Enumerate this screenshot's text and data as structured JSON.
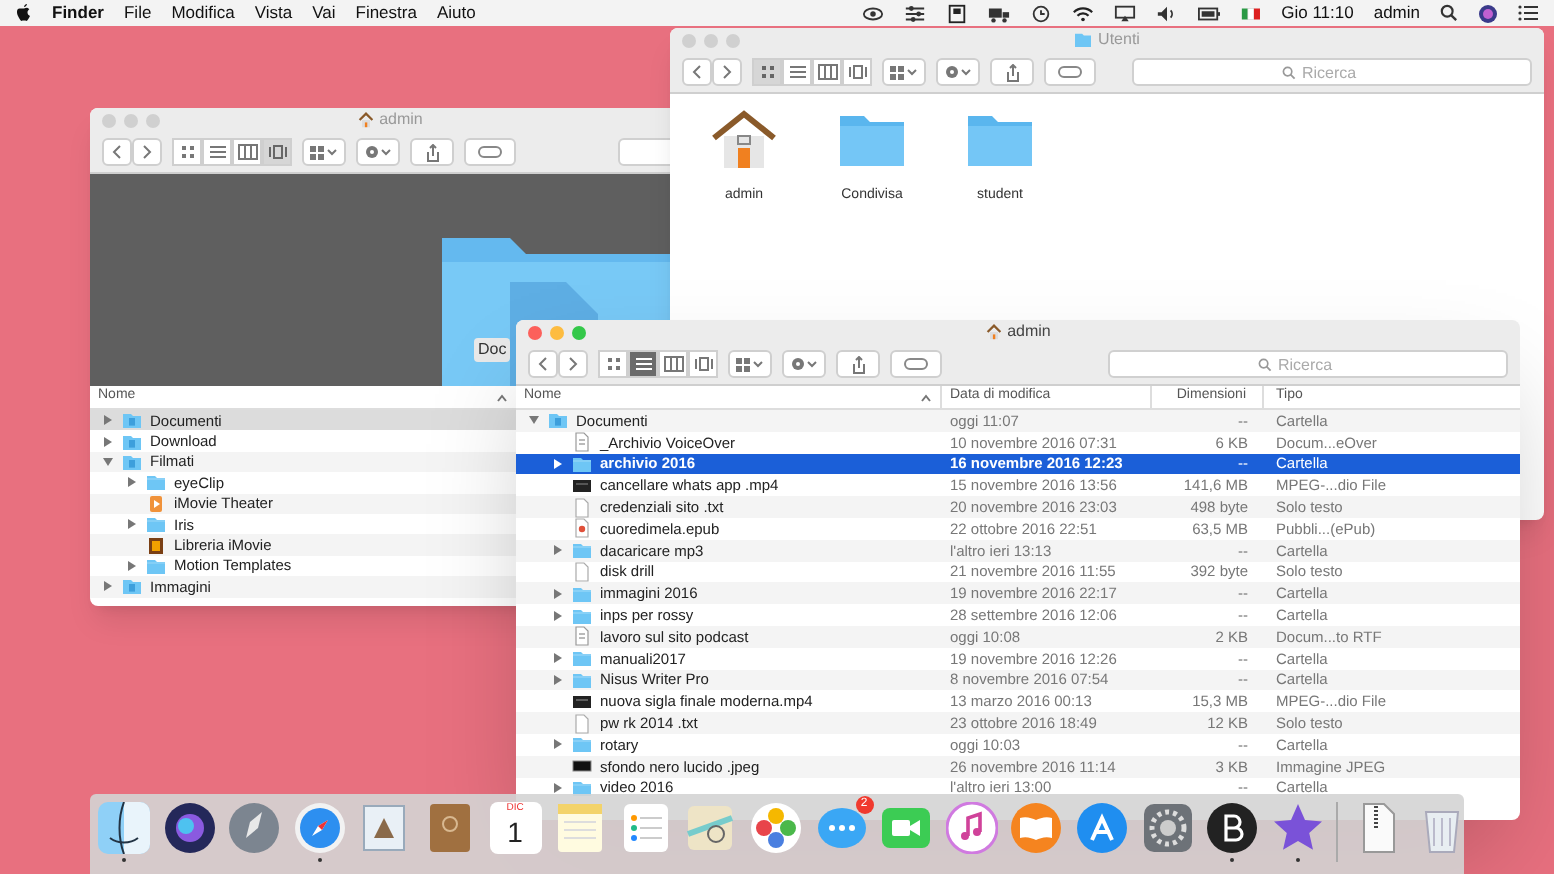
{
  "menu_bar": {
    "app": "Finder",
    "menus": [
      "File",
      "Modifica",
      "Vista",
      "Vai",
      "Finestra",
      "Aiuto"
    ],
    "clock": "Gio 11:10",
    "user": "admin"
  },
  "back_window": {
    "title": "admin",
    "active": false,
    "view_buttons": [
      {
        "kind": "icons",
        "selected": false
      },
      {
        "kind": "list",
        "selected": false
      },
      {
        "kind": "columns",
        "selected": false
      },
      {
        "kind": "cover",
        "selected": true
      }
    ],
    "preview_label": "Doc",
    "columns": [
      "Nome"
    ],
    "rows": [
      {
        "name": "Documenti",
        "kind": "docfolder",
        "selected": true,
        "expanded": false
      },
      {
        "name": "Download",
        "kind": "docfolder",
        "selected": false,
        "expanded": false
      },
      {
        "name": "Filmati",
        "kind": "docfolder",
        "selected": false,
        "expanded": true,
        "children": [
          {
            "name": "eyeClip",
            "kind": "folder",
            "selected": false,
            "expanded": false
          },
          {
            "name": "iMovie Theater",
            "kind": "app",
            "selected": false
          },
          {
            "name": "Iris",
            "kind": "folder",
            "selected": false,
            "expanded": false
          },
          {
            "name": "Libreria iMovie",
            "kind": "library",
            "selected": false
          },
          {
            "name": "Motion Templates",
            "kind": "folder",
            "selected": false,
            "expanded": false
          }
        ]
      },
      {
        "name": "Immagini",
        "kind": "docfolder",
        "selected": false,
        "expanded": false
      }
    ]
  },
  "users_window": {
    "title": "Utenti",
    "active": false,
    "view_buttons": [
      {
        "kind": "icons",
        "selected": true
      },
      {
        "kind": "list",
        "selected": false
      },
      {
        "kind": "columns",
        "selected": false
      },
      {
        "kind": "cover",
        "selected": false
      }
    ],
    "search": {
      "placeholder": "Ricerca"
    },
    "items": [
      {
        "kind": "home",
        "label": "admin"
      },
      {
        "kind": "folder",
        "label": "Condivisa"
      },
      {
        "kind": "folder",
        "label": "student"
      }
    ]
  },
  "front_window": {
    "title": "admin",
    "active": true,
    "view_buttons": [
      {
        "kind": "icons",
        "selected": false
      },
      {
        "kind": "list",
        "selected": true
      },
      {
        "kind": "columns",
        "selected": false
      },
      {
        "kind": "cover",
        "selected": false
      }
    ],
    "search": {
      "placeholder": "Ricerca"
    },
    "columns": [
      "Nome",
      "Data di modifica",
      "Dimensioni",
      "Tipo"
    ],
    "rows": [
      {
        "name": "Documenti",
        "kind": "docfolder",
        "date": "oggi 11:07",
        "size": "--",
        "type": "Cartella",
        "selected": false,
        "expanded": true,
        "children": [
          {
            "name": "_Archivio VoiceOver",
            "kind": "document",
            "date": "10 novembre 2016 07:31",
            "size": "6 KB",
            "type": "Docum...eOver",
            "selected": false
          },
          {
            "name": "archivio 2016",
            "kind": "folder",
            "date": "16 novembre 2016 12:23",
            "size": "--",
            "type": "Cartella",
            "selected": true,
            "expanded": false
          },
          {
            "name": "cancellare whats app .mp4",
            "kind": "video",
            "date": "15 novembre 2016 13:56",
            "size": "141,6 MB",
            "type": "MPEG-...dio File",
            "selected": false
          },
          {
            "name": "credenziali sito .txt",
            "kind": "text",
            "date": "20 novembre 2016 23:03",
            "size": "498 byte",
            "type": "Solo testo",
            "selected": false
          },
          {
            "name": "cuoredimela.epub",
            "kind": "epub",
            "date": "22 ottobre 2016 22:51",
            "size": "63,5 MB",
            "type": "Pubbli...(ePub)",
            "selected": false
          },
          {
            "name": "dacaricare mp3",
            "kind": "folder",
            "date": "l'altro ieri 13:13",
            "size": "--",
            "type": "Cartella",
            "selected": false,
            "expanded": false
          },
          {
            "name": "disk drill",
            "kind": "text",
            "date": "21 novembre 2016 11:55",
            "size": "392 byte",
            "type": "Solo testo",
            "selected": false
          },
          {
            "name": "immagini 2016",
            "kind": "folder",
            "date": "19 novembre 2016 22:17",
            "size": "--",
            "type": "Cartella",
            "selected": false,
            "expanded": false
          },
          {
            "name": "inps per  rossy",
            "kind": "folder",
            "date": "28 settembre 2016 12:06",
            "size": "--",
            "type": "Cartella",
            "selected": false,
            "expanded": false
          },
          {
            "name": "lavoro sul sito podcast",
            "kind": "document",
            "date": "oggi 10:08",
            "size": "2 KB",
            "type": "Docum...to RTF",
            "selected": false
          },
          {
            "name": "manuali2017",
            "kind": "folder",
            "date": "19 novembre 2016 12:26",
            "size": "--",
            "type": "Cartella",
            "selected": false,
            "expanded": false
          },
          {
            "name": "Nisus Writer Pro",
            "kind": "folder",
            "date": "8 novembre 2016 07:54",
            "size": "--",
            "type": "Cartella",
            "selected": false,
            "expanded": false
          },
          {
            "name": "nuova sigla finale moderna.mp4",
            "kind": "video",
            "date": "13 marzo 2016 00:13",
            "size": "15,3 MB",
            "type": "MPEG-...dio File",
            "selected": false
          },
          {
            "name": "pw rk 2014 .txt",
            "kind": "text",
            "date": "23 ottobre 2016 18:49",
            "size": "12 KB",
            "type": "Solo testo",
            "selected": false
          },
          {
            "name": "rotary",
            "kind": "folder",
            "date": "oggi 10:03",
            "size": "--",
            "type": "Cartella",
            "selected": false,
            "expanded": false
          },
          {
            "name": "sfondo nero lucido .jpeg",
            "kind": "image",
            "date": "26 novembre 2016 11:14",
            "size": "3 KB",
            "type": "Immagine JPEG",
            "selected": false
          },
          {
            "name": "video 2016",
            "kind": "folder",
            "date": "l'altro ieri 13:00",
            "size": "--",
            "type": "Cartella",
            "selected": false,
            "expanded": false
          }
        ]
      }
    ]
  },
  "dock": {
    "items": [
      {
        "kind": "finder",
        "running": true
      },
      {
        "kind": "siri",
        "running": false
      },
      {
        "kind": "launchpad",
        "running": false
      },
      {
        "kind": "safari",
        "running": true
      },
      {
        "kind": "mail",
        "running": false
      },
      {
        "kind": "contacts",
        "running": false
      },
      {
        "kind": "calendar",
        "month": "DIC",
        "day": "1",
        "running": false
      },
      {
        "kind": "notes",
        "running": false
      },
      {
        "kind": "reminders",
        "running": false
      },
      {
        "kind": "maps",
        "running": false
      },
      {
        "kind": "photos",
        "running": false
      },
      {
        "kind": "messages",
        "badge": "2",
        "running": false
      },
      {
        "kind": "facetime",
        "running": false
      },
      {
        "kind": "music",
        "running": false
      },
      {
        "kind": "books",
        "running": false
      },
      {
        "kind": "appstore",
        "running": false
      },
      {
        "kind": "preferences",
        "running": false
      },
      {
        "kind": "letter",
        "running": true
      },
      {
        "kind": "star",
        "running": true
      },
      {
        "kind": "archive",
        "running": false
      },
      {
        "kind": "trash",
        "running": false
      }
    ]
  }
}
